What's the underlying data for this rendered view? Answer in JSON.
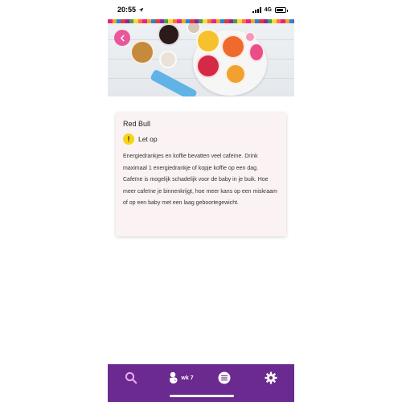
{
  "status_bar": {
    "time": "20:55",
    "network": "4G"
  },
  "hero": {
    "back_icon": "chevron-left-icon"
  },
  "card": {
    "title": "Red Bull",
    "warning_label": "Let op",
    "warning_icon": "exclamation-icon",
    "body": "Energiedrankjes en koffie bevatten veel cafeïne. Drink maximaal 1 energiedrankje of kopje koffie op een dag. Cafeïne is mogelijk schadelijk voor de baby in je buik. Hoe meer cafeïne je binnenkrijgt, hoe meer kans op een miskraam of op een baby met een laag geboortegewicht."
  },
  "bottom_nav": {
    "items": [
      {
        "icon": "search-icon"
      },
      {
        "icon": "baby-icon",
        "label": "wk 7"
      },
      {
        "icon": "list-icon"
      },
      {
        "icon": "gear-icon"
      }
    ]
  },
  "colors": {
    "nav_background": "#6b2a8f",
    "accent_pink": "#e8579b",
    "warning_yellow": "#f7d417",
    "card_background": "#fbf3f3"
  }
}
